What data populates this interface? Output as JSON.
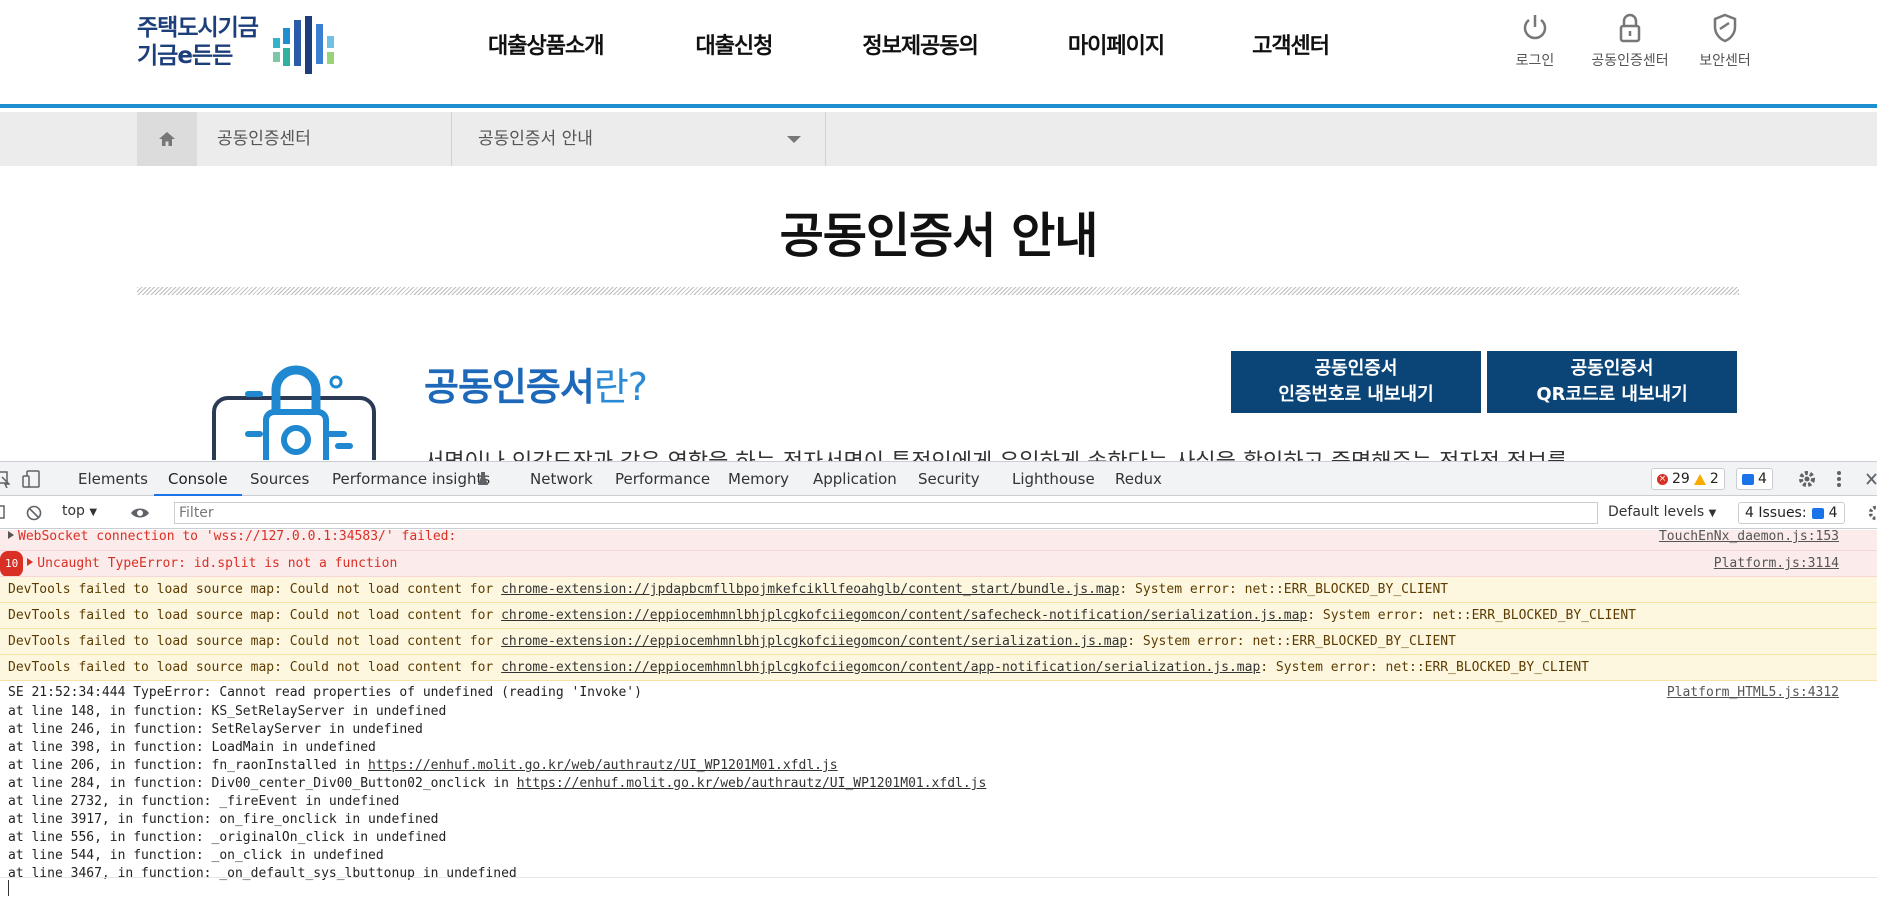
{
  "site": {
    "logo": {
      "line1": "주택도시기금",
      "line2": "기금e든든"
    },
    "nav": [
      "대출상품소개",
      "대출신청",
      "정보제공동의",
      "마이페이지",
      "고객센터"
    ],
    "util": {
      "login": "로그인",
      "cert_center": "공동인증센터",
      "security_center": "보안센터"
    },
    "accent_color": "#1b8fd0",
    "button_color": "#0b4577"
  },
  "breadcrumb": {
    "level1": "공동인증센터",
    "level2": "공동인증서 안내"
  },
  "content": {
    "title": "공동인증서 안내",
    "heading_highlight": "공동인증서",
    "heading_rest": "란?",
    "export_auth_code": {
      "line1": "공동인증서",
      "line2": "인증번호로 내보내기"
    },
    "export_qr": {
      "line1": "공동인증서",
      "line2": "QR코드로 내보내기"
    },
    "description_cut": "서명이나 인감도장과 같은 역할을 하는 전자서명이 특정인에게 유일하게 속한다는 사실을 확인하고 증명해주는 전자적 정보를"
  },
  "devtools": {
    "tabs": [
      "Elements",
      "Console",
      "Sources",
      "Performance insights",
      "Network",
      "Performance",
      "Memory",
      "Application",
      "Security",
      "Lighthouse",
      "Redux"
    ],
    "active_tab": "Console",
    "errors_count": "29",
    "warnings_count": "2",
    "messages_count": "4",
    "context": "top",
    "filter_placeholder": "Filter",
    "levels": "Default levels",
    "issues_label": "4 Issues:",
    "issues_count": "4",
    "console": {
      "ws_error": {
        "text": "WebSocket connection to 'wss://127.0.0.1:34583/' failed:",
        "source": "TouchEnNx_daemon.js:153"
      },
      "type_error": {
        "count": "10",
        "text": "Uncaught TypeError: id.split is not a function",
        "source": "Platform.js:3114"
      },
      "sourcemap_warnings": [
        {
          "prefix": "DevTools failed to load source map: Could not load content for ",
          "url": "chrome-extension://jpdapbcmfllbpojmkefcikllfeoahglb/content_start/bundle.js.map",
          "suffix": ": System error: net::ERR_BLOCKED_BY_CLIENT"
        },
        {
          "prefix": "DevTools failed to load source map: Could not load content for ",
          "url": "chrome-extension://eppiocemhmnlbhjplcgkofciiegomcon/content/safecheck-notification/serialization.js.map",
          "suffix": ": System error: net::ERR_BLOCKED_BY_CLIENT"
        },
        {
          "prefix": "DevTools failed to load source map: Could not load content for ",
          "url": "chrome-extension://eppiocemhmnlbhjplcgkofciiegomcon/content/serialization.js.map",
          "suffix": ": System error: net::ERR_BLOCKED_BY_CLIENT"
        },
        {
          "prefix": "DevTools failed to load source map: Could not load content for ",
          "url": "chrome-extension://eppiocemhmnlbhjplcgkofciiegomcon/content/app-notification/serialization.js.map",
          "suffix": ": System error: net::ERR_BLOCKED_BY_CLIENT"
        }
      ],
      "trace_header": {
        "text": "SE 21:52:34:444 TypeError: Cannot read properties of undefined (reading 'Invoke')",
        "source": "Platform_HTML5.js:4312"
      },
      "trace_lines": [
        {
          "text": "at line 148, in function: KS_SetRelayServer in undefined",
          "link": ""
        },
        {
          "text": "at line 246, in function: SetRelayServer in undefined",
          "link": ""
        },
        {
          "text": "at line 398, in function: LoadMain in undefined",
          "link": ""
        },
        {
          "text": "at line 206, in function: fn_raonInstalled in ",
          "link": "https://enhuf.molit.go.kr/web/authrautz/UI_WP1201M01.xfdl.js"
        },
        {
          "text": "at line 284, in function: Div00_center_Div00_Button02_onclick in ",
          "link": "https://enhuf.molit.go.kr/web/authrautz/UI_WP1201M01.xfdl.js"
        },
        {
          "text": "at line 2732, in function: _fireEvent in undefined",
          "link": ""
        },
        {
          "text": "at line 3917, in function: on_fire_onclick in undefined",
          "link": ""
        },
        {
          "text": "at line 556, in function: _originalOn_click in undefined",
          "link": ""
        },
        {
          "text": "at line 544, in function: _on_click in undefined",
          "link": ""
        },
        {
          "text": "at line 3467, in function: _on_default_sys_lbuttonup in undefined",
          "link": ""
        }
      ]
    }
  }
}
